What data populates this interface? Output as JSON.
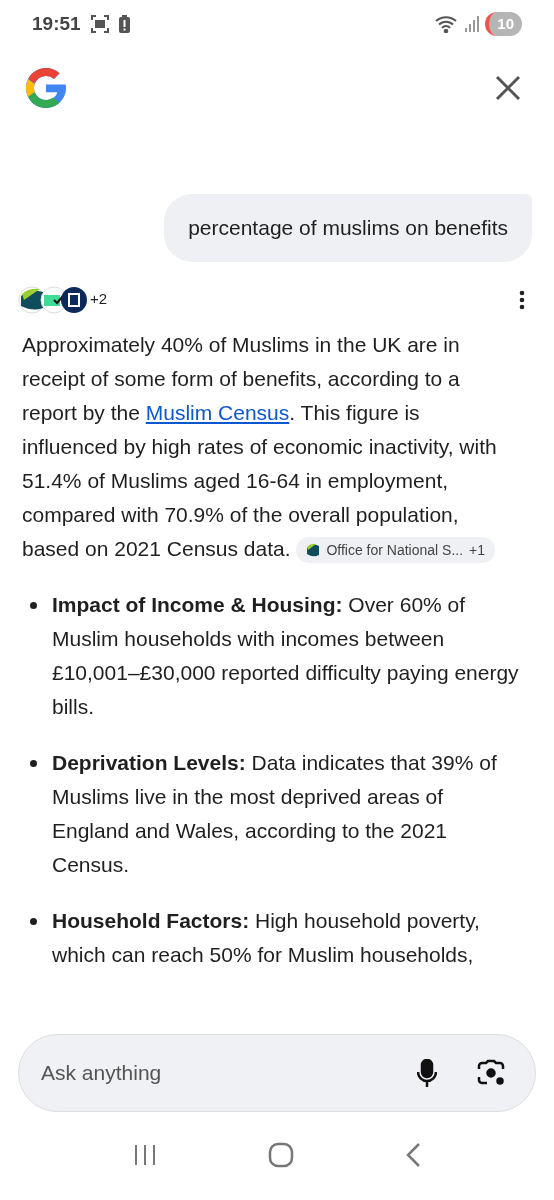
{
  "status_bar": {
    "time": "19:51",
    "battery": "10"
  },
  "query": "percentage of muslims on benefits",
  "sources": {
    "more": "+2"
  },
  "answer": {
    "before": "Approximately 40% of Muslims in the UK are in receipt of some form of benefits, according to a report by the ",
    "link": "Muslim Census",
    "after": ". This figure is influenced by high rates of economic inactivity, with 51.4% of Muslims aged 16-64 in employment, compared with 70.9% of the overall population, based on 2021 Census data.",
    "chip": {
      "label": "Office for National S...",
      "more": "+1"
    }
  },
  "bullets": [
    {
      "heading": "Impact of Income & Housing:",
      "text": "Over 60% of Muslim households with incomes between £10,001–£30,000 reported difficulty paying energy bills."
    },
    {
      "heading": "Deprivation Levels:",
      "text": "Data indicates that 39% of Muslims live in the most deprived areas of England and Wales, according to the 2021 Census."
    },
    {
      "heading": "Household Factors:",
      "text": "High household poverty, which can reach 50% for Muslim households,"
    }
  ],
  "input": {
    "placeholder": "Ask anything"
  }
}
